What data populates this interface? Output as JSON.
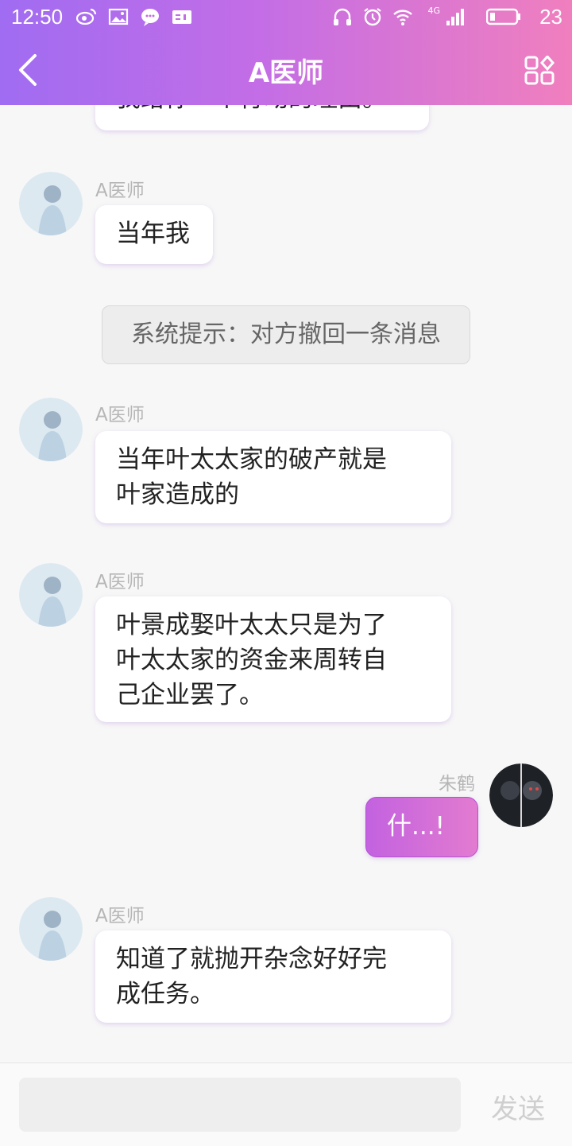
{
  "status_bar": {
    "time": "12:50",
    "network": "4G",
    "battery": "23"
  },
  "header": {
    "title": "A医师"
  },
  "messages": {
    "partial_top": "我给你一个行动的理由。",
    "m1": {
      "sender": "A医师",
      "text": "当年我"
    },
    "system": "系统提示：对方撤回一条消息",
    "m2": {
      "sender": "A医师",
      "line1": "当年叶太太家的破产就是",
      "line2": "叶家造成的"
    },
    "m3": {
      "sender": "A医师",
      "line1": "叶景成娶叶太太只是为了",
      "line2": "叶太太家的资金来周转自",
      "line3": "己企业罢了。"
    },
    "m4": {
      "sender": "朱鹤",
      "text": "什...!"
    },
    "m5": {
      "sender": "A医师",
      "line1": "知道了就抛开杂念好好完",
      "line2": "成任务。"
    }
  },
  "input": {
    "placeholder": "",
    "send_label": "发送"
  },
  "colors": {
    "header_gradient_start": "#a06cf2",
    "header_gradient_end": "#f07fbe",
    "own_bubble": "#c362e0"
  }
}
